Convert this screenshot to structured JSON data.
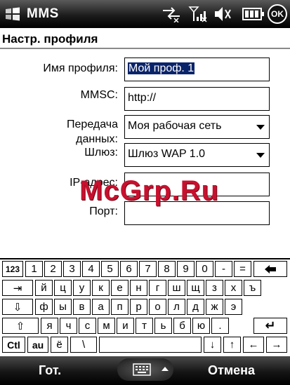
{
  "titlebar": {
    "app_title": "MMS",
    "ok_label": "OK"
  },
  "section_title": "Настр. профиля",
  "form": {
    "profile_name_label": "Имя профиля:",
    "profile_name_value": "Мой проф. 1",
    "mmsc_label": "MMSC:",
    "mmsc_value": "http://",
    "data_transfer_label_line1": "Передача",
    "data_transfer_label_line2": "данных:",
    "data_transfer_value": "Моя рабочая сеть",
    "gateway_label": "Шлюз:",
    "gateway_value": "Шлюз WAP 1.0",
    "ip_label": "IP-адрес:",
    "ip_value": "",
    "port_label": "Порт:",
    "port_value": ""
  },
  "watermark": "McGrp.Ru",
  "keyboard": {
    "row1": [
      "123",
      "1",
      "2",
      "3",
      "4",
      "5",
      "6",
      "7",
      "8",
      "9",
      "0",
      "-",
      "=",
      "◆"
    ],
    "row2": [
      "⇥",
      "й",
      "ц",
      "у",
      "к",
      "е",
      "н",
      "г",
      "ш",
      "щ",
      "з",
      "х",
      "ъ"
    ],
    "row3": [
      "⇩",
      "ф",
      "ы",
      "в",
      "а",
      "п",
      "р",
      "о",
      "л",
      "д",
      "ж",
      "э"
    ],
    "row4": [
      "⇧",
      "я",
      "ч",
      "с",
      "м",
      "и",
      "т",
      "ь",
      "б",
      "ю",
      ".",
      "↵"
    ],
    "row5": [
      "Ctl",
      "au",
      "ё",
      "\\",
      "",
      "↓",
      "↑",
      "←",
      "→"
    ]
  },
  "softkeys": {
    "left": "Гот.",
    "right": "Отмена"
  }
}
